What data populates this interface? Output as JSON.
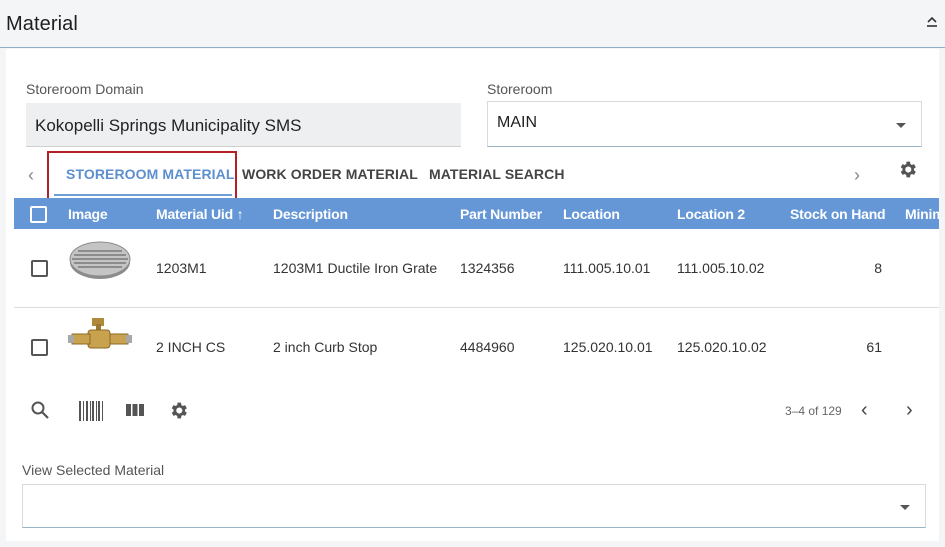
{
  "header": {
    "title": "Material"
  },
  "form": {
    "storeroom_domain_label": "Storeroom Domain",
    "storeroom_domain_value": "Kokopelli Springs Municipality SMS",
    "storeroom_label": "Storeroom",
    "storeroom_value": "MAIN"
  },
  "tabs": [
    {
      "label": "STOREROOM MATERIAL",
      "active": true
    },
    {
      "label": "WORK ORDER MATERIAL",
      "active": false
    },
    {
      "label": "MATERIAL SEARCH",
      "active": false
    }
  ],
  "table": {
    "columns": [
      "Image",
      "Material Uid",
      "Description",
      "Part Number",
      "Location",
      "Location 2",
      "Stock on Hand",
      "Minim"
    ],
    "sort_indicator": "↑",
    "rows": [
      {
        "image": "drain-grate-image",
        "uid": "1203M1",
        "description": "1203M1 Ductile Iron Grate",
        "part_number": "1324356",
        "location": "111.005.10.01",
        "location2": "111.005.10.02",
        "stock": "8"
      },
      {
        "image": "curb-stop-valve-image",
        "uid": "2 INCH CS",
        "description": "2 inch Curb Stop",
        "part_number": "4484960",
        "location": "125.020.10.01",
        "location2": "125.020.10.02",
        "stock": "61"
      }
    ]
  },
  "pager": {
    "text": "3–4 of 129"
  },
  "view_selected": {
    "label": "View Selected Material",
    "value": ""
  },
  "colors": {
    "header_bg": "#6597d6",
    "active_tab": "#5d8fcf",
    "highlight": "#b21f24"
  }
}
